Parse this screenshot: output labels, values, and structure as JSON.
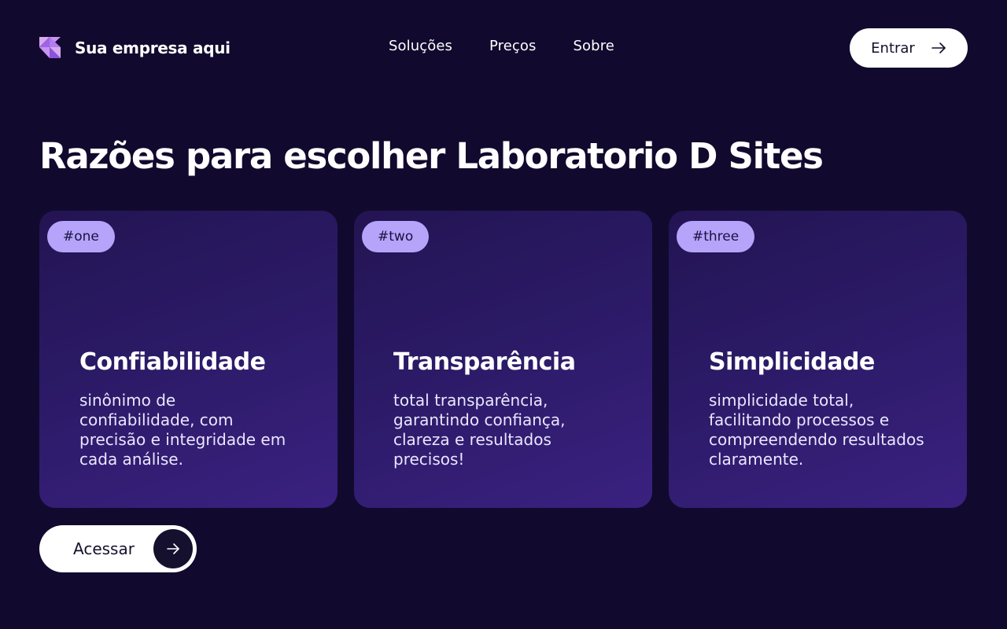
{
  "header": {
    "brand": "Sua empresa aqui",
    "nav": [
      "Soluções",
      "Preços",
      "Sobre"
    ],
    "login_label": "Entrar"
  },
  "main": {
    "heading": "Razões para escolher Laboratorio D Sites",
    "cards": [
      {
        "tag": "#one",
        "title": "Confiabilidade",
        "text": "sinônimo de confiabilidade, com precisão e integridade em cada análise."
      },
      {
        "tag": "#two",
        "title": "Transparência",
        "text": "total transparência, garantindo confiança, clareza e resultados precisos!"
      },
      {
        "tag": "#three",
        "title": "Simplicidade",
        "text": "simplicidade total, facilitando processos e compreendendo resultados claramente."
      }
    ],
    "cta_label": "Acessar"
  },
  "icons": {
    "logo": "logo-icon",
    "login_arrow": "arrow-right-icon",
    "cta_arrow": "arrow-right-icon"
  },
  "colors": {
    "background": "#110a2e",
    "card_gradient_start": "#231453",
    "card_gradient_end": "#3a2180",
    "tag": "#b5a4fa",
    "logo_accent": "#c9a2f5"
  }
}
